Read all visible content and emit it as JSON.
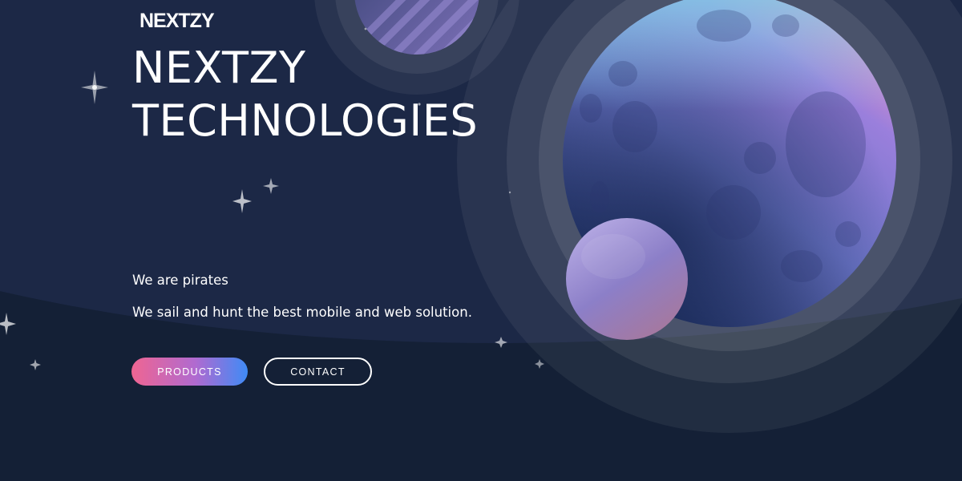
{
  "brand": {
    "logo_text": "NEXTZY"
  },
  "hero": {
    "title_line1": "NEXTZY",
    "title_line2": "TECHNOLOGIES",
    "tagline": "We are pirates",
    "subtagline": "We sail and hunt the best mobile and web solution."
  },
  "actions": {
    "products_label": "PRODUCTS",
    "contact_label": "CONTACT"
  },
  "colors": {
    "background": "#142036",
    "text": "#ffffff",
    "products_gradient_start": "#ef6592",
    "products_gradient_end": "#3f8bf6"
  }
}
